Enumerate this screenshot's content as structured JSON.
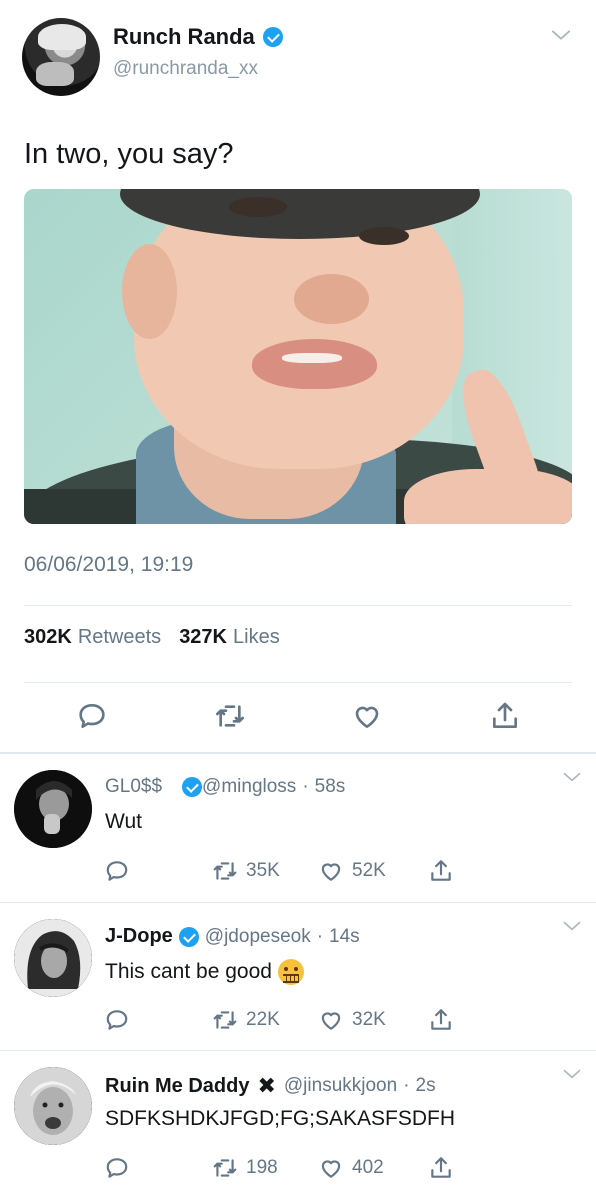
{
  "main_tweet": {
    "display_name": "Runch Randa",
    "handle": "@runchranda_xx",
    "text": "In two, you say?",
    "timestamp": "06/06/2019, 19:19",
    "retweets_count": "302K",
    "retweets_label": "Retweets",
    "likes_count": "327K",
    "likes_label": "Likes",
    "verified": true,
    "icons": [
      "chevron-down-icon",
      "reply-icon",
      "retweet-icon",
      "like-icon",
      "share-icon"
    ]
  },
  "replies": [
    {
      "display_name": "GL0$$",
      "handle": "@mingloss",
      "time": "58s",
      "text": "Wut",
      "retweets": "35K",
      "likes": "52K",
      "verified": true
    },
    {
      "display_name": "J-Dope",
      "handle": "@jdopeseok",
      "time": "14s",
      "text": "This cant be good",
      "emoji": "zipper-mouth-face",
      "retweets": "22K",
      "likes": "32K",
      "verified": true
    },
    {
      "display_name": "Ruin Me Daddy",
      "badge": "✖",
      "handle": "@jinsukkjoon",
      "time": "2s",
      "text": "SDFKSHDKJFGD;FG;SAKASFSDFH",
      "retweets": "198",
      "likes": "402",
      "verified": false
    }
  ],
  "colors": {
    "accent": "#1da1f2",
    "muted": "#657786",
    "divider": "#e1e8ed",
    "text": "#14171a"
  }
}
